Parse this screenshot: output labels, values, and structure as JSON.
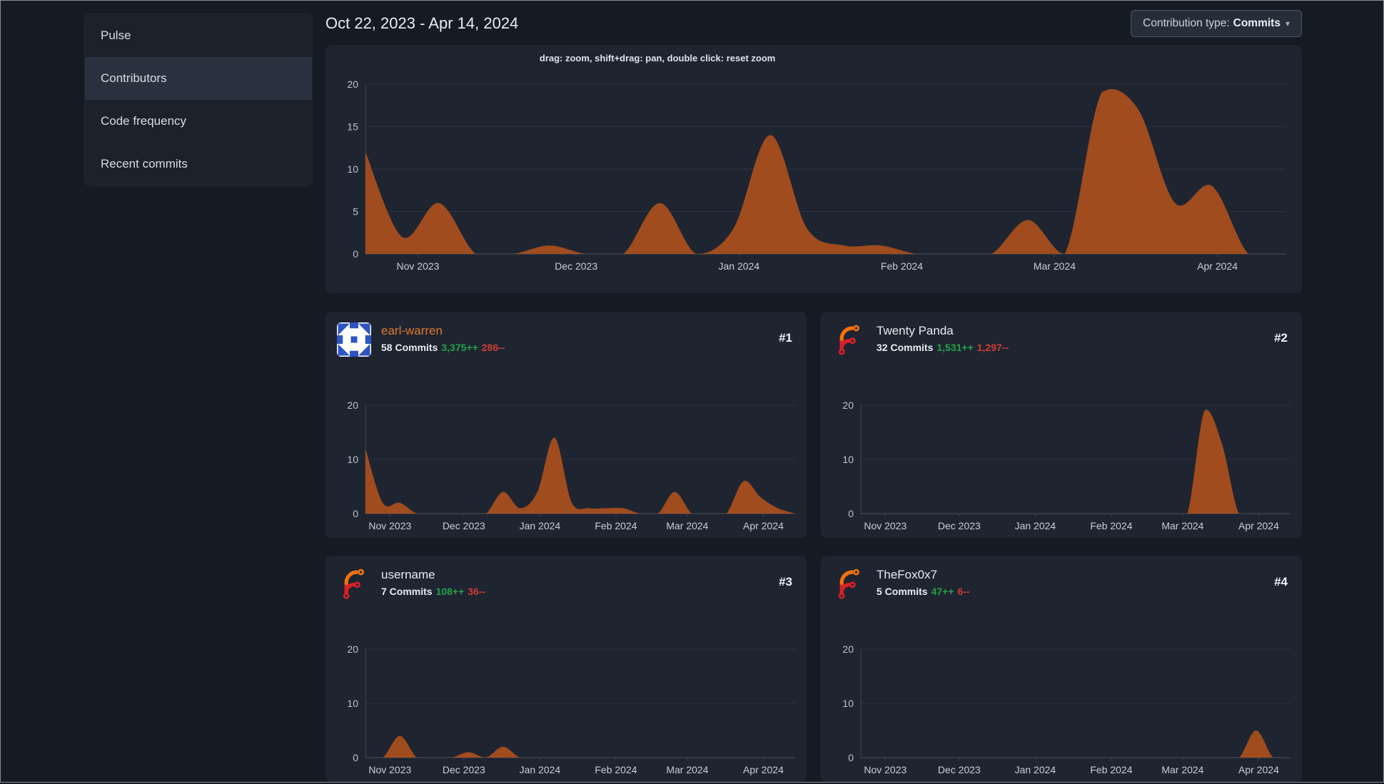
{
  "sidebar": {
    "items": [
      {
        "label": "Pulse",
        "active": false
      },
      {
        "label": "Contributors",
        "active": true
      },
      {
        "label": "Code frequency",
        "active": false
      },
      {
        "label": "Recent commits",
        "active": false
      }
    ]
  },
  "header": {
    "date_range": "Oct 22, 2023 - Apr 14, 2024",
    "contribution_type_label": "Contribution type:",
    "contribution_type_value": "Commits",
    "caret_icon": "▾"
  },
  "main_chart": {
    "hint": "drag: zoom, shift+drag: pan, double click: reset zoom"
  },
  "contributors": [
    {
      "rank": "#1",
      "name": "earl-warren",
      "is_link": true,
      "avatar_icon": "identicon-avatar",
      "commits_text": "58 Commits",
      "additions": "3,375++",
      "deletions": "286--"
    },
    {
      "rank": "#2",
      "name": "Twenty Panda",
      "is_link": false,
      "avatar_icon": "forgejo-logo-avatar",
      "commits_text": "32 Commits",
      "additions": "1,531++",
      "deletions": "1,297--"
    },
    {
      "rank": "#3",
      "name": "username",
      "is_link": false,
      "avatar_icon": "forgejo-logo-avatar",
      "commits_text": "7 Commits",
      "additions": "108++",
      "deletions": "36--"
    },
    {
      "rank": "#4",
      "name": "TheFox0x7",
      "is_link": false,
      "avatar_icon": "forgejo-logo-avatar",
      "commits_text": "5 Commits",
      "additions": "47++",
      "deletions": "6--"
    }
  ],
  "colors": {
    "area_fill": "#a04c1e",
    "link_orange": "#e0782e",
    "additions_green": "#26a148",
    "deletions_red": "#cf3c33"
  },
  "chart_data": [
    {
      "id": "total-contributions",
      "type": "area",
      "x_start": "Oct 22, 2023",
      "x_end": "Apr 14, 2024",
      "point_interval": "weekly",
      "values": [
        12,
        2,
        6,
        0,
        0,
        1,
        0,
        0,
        6,
        0,
        3,
        14,
        3,
        1,
        1,
        0,
        0,
        0,
        4,
        0,
        19,
        17,
        6,
        8,
        0,
        0
      ],
      "ylim": [
        0,
        20
      ],
      "yticks": [
        0,
        5,
        10,
        15,
        20
      ],
      "x_tick_labels": [
        "Nov 2023",
        "Dec 2023",
        "Jan 2024",
        "Feb 2024",
        "Mar 2024",
        "Apr 2024"
      ],
      "x_tick_fractions": [
        0.057,
        0.229,
        0.406,
        0.583,
        0.749,
        0.926
      ],
      "color": "#a04c1e",
      "grid": true
    },
    {
      "id": "earl-warren",
      "type": "area",
      "x_start": "Oct 22, 2023",
      "x_end": "Apr 14, 2024",
      "point_interval": "weekly",
      "values": [
        12,
        2,
        2,
        0,
        0,
        0,
        0,
        0,
        4,
        1,
        4,
        14,
        2,
        1,
        1,
        1,
        0,
        0,
        4,
        0,
        0,
        0,
        6,
        3,
        1,
        0
      ],
      "ylim": [
        0,
        20
      ],
      "yticks": [
        0,
        10,
        20
      ],
      "x_tick_labels": [
        "Nov 2023",
        "Dec 2023",
        "Jan 2024",
        "Feb 2024",
        "Mar 2024",
        "Apr 2024"
      ],
      "x_tick_fractions": [
        0.057,
        0.229,
        0.406,
        0.583,
        0.749,
        0.926
      ],
      "color": "#a04c1e",
      "grid": true
    },
    {
      "id": "twenty-panda",
      "type": "area",
      "x_start": "Oct 22, 2023",
      "x_end": "Apr 14, 2024",
      "point_interval": "weekly",
      "values": [
        0,
        0,
        0,
        0,
        0,
        0,
        0,
        0,
        0,
        0,
        0,
        0,
        0,
        0,
        0,
        0,
        0,
        0,
        0,
        0,
        19,
        13,
        0,
        0,
        0,
        0
      ],
      "ylim": [
        0,
        20
      ],
      "yticks": [
        0,
        10,
        20
      ],
      "x_tick_labels": [
        "Nov 2023",
        "Dec 2023",
        "Jan 2024",
        "Feb 2024",
        "Mar 2024",
        "Apr 2024"
      ],
      "x_tick_fractions": [
        0.057,
        0.229,
        0.406,
        0.583,
        0.749,
        0.926
      ],
      "color": "#a04c1e",
      "grid": true
    },
    {
      "id": "username",
      "type": "area",
      "x_start": "Oct 22, 2023",
      "x_end": "Apr 14, 2024",
      "point_interval": "weekly",
      "values": [
        0,
        0,
        4,
        0,
        0,
        0,
        1,
        0,
        2,
        0,
        0,
        0,
        0,
        0,
        0,
        0,
        0,
        0,
        0,
        0,
        0,
        0,
        0,
        0,
        0,
        0
      ],
      "ylim": [
        0,
        20
      ],
      "yticks": [
        0,
        10,
        20
      ],
      "x_tick_labels": [
        "Nov 2023",
        "Dec 2023",
        "Jan 2024",
        "Feb 2024",
        "Mar 2024",
        "Apr 2024"
      ],
      "x_tick_fractions": [
        0.057,
        0.229,
        0.406,
        0.583,
        0.749,
        0.926
      ],
      "color": "#a04c1e",
      "grid": true
    },
    {
      "id": "thefox0x7",
      "type": "area",
      "x_start": "Oct 22, 2023",
      "x_end": "Apr 14, 2024",
      "point_interval": "weekly",
      "values": [
        0,
        0,
        0,
        0,
        0,
        0,
        0,
        0,
        0,
        0,
        0,
        0,
        0,
        0,
        0,
        0,
        0,
        0,
        0,
        0,
        0,
        0,
        0,
        5,
        0,
        0
      ],
      "ylim": [
        0,
        20
      ],
      "yticks": [
        0,
        10,
        20
      ],
      "x_tick_labels": [
        "Nov 2023",
        "Dec 2023",
        "Jan 2024",
        "Feb 2024",
        "Mar 2024",
        "Apr 2024"
      ],
      "x_tick_fractions": [
        0.057,
        0.229,
        0.406,
        0.583,
        0.749,
        0.926
      ],
      "color": "#a04c1e",
      "grid": true
    }
  ]
}
